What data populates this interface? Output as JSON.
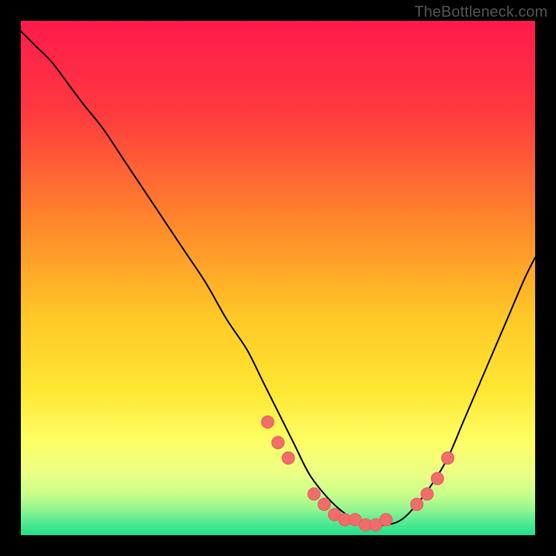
{
  "watermark": "TheBottleneck.com",
  "colors": {
    "bg": "#000000",
    "curve": "#000000",
    "dot_fill": "#ef6d6a",
    "dot_stroke": "#e65a57",
    "grad_top": "#ff1a4d",
    "grad_mid1": "#ff7a33",
    "grad_mid2": "#ffd400",
    "grad_mid3": "#ffff66",
    "grad_mid4": "#ccff66",
    "grad_bot": "#1fe08a"
  },
  "gradient_stops": [
    {
      "offset": "0%",
      "color": "#ff1a4d"
    },
    {
      "offset": "18%",
      "color": "#ff3a3e"
    },
    {
      "offset": "40%",
      "color": "#ff8a2b"
    },
    {
      "offset": "58%",
      "color": "#ffc927"
    },
    {
      "offset": "72%",
      "color": "#ffe733"
    },
    {
      "offset": "82%",
      "color": "#fdff66"
    },
    {
      "offset": "88%",
      "color": "#eaff85"
    },
    {
      "offset": "92%",
      "color": "#c9ff8a"
    },
    {
      "offset": "95%",
      "color": "#93f58f"
    },
    {
      "offset": "97%",
      "color": "#5fec93"
    },
    {
      "offset": "100%",
      "color": "#1fe08a"
    }
  ],
  "chart_data": {
    "type": "line",
    "title": "",
    "xlabel": "",
    "ylabel": "",
    "xlim": [
      0,
      100
    ],
    "ylim": [
      0,
      100
    ],
    "grid": false,
    "legend": false,
    "series": [
      {
        "name": "bottleneck-curve",
        "x": [
          0,
          3,
          6,
          9,
          12,
          16,
          20,
          24,
          28,
          32,
          36,
          40,
          44,
          47,
          50,
          53,
          56,
          59,
          62,
          65,
          68,
          71,
          74,
          77,
          80,
          83,
          86,
          89,
          92,
          95,
          98,
          100
        ],
        "y": [
          98,
          95,
          92,
          88,
          84,
          79,
          73,
          67,
          61,
          55,
          49,
          42,
          36,
          30,
          24,
          18,
          12,
          8,
          5,
          3,
          2,
          2,
          3,
          6,
          10,
          15,
          22,
          29,
          36,
          43,
          50,
          54
        ]
      }
    ],
    "markers": {
      "name": "highlight-dots",
      "x": [
        48,
        50,
        52,
        57,
        59,
        61,
        63,
        65,
        67,
        69,
        71,
        77,
        79,
        81,
        83
      ],
      "y": [
        22,
        18,
        15,
        8,
        6,
        4,
        3,
        3,
        2,
        2,
        3,
        6,
        8,
        11,
        15
      ]
    }
  }
}
